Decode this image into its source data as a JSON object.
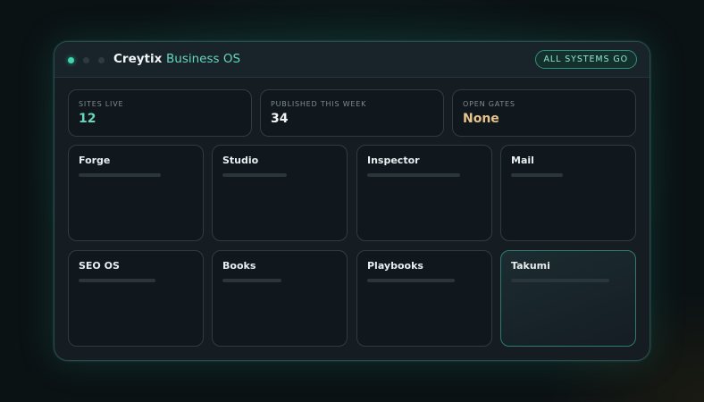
{
  "window": {
    "brand": "Creytix",
    "product": "Business OS",
    "status": "ALL SYSTEMS GO"
  },
  "stats": [
    {
      "label": "SITES LIVE",
      "value": "12",
      "color": "#66d6be"
    },
    {
      "label": "PUBLISHED THIS WEEK",
      "value": "34",
      "color": "#f1f5f6"
    },
    {
      "label": "OPEN GATES",
      "value": "None",
      "color": "#e8c48c"
    }
  ],
  "apps": [
    {
      "name": "Forge",
      "active": false
    },
    {
      "name": "Studio",
      "active": false
    },
    {
      "name": "Inspector",
      "active": false
    },
    {
      "name": "Mail",
      "active": false
    },
    {
      "name": "SEO OS",
      "active": false
    },
    {
      "name": "Books",
      "active": false
    },
    {
      "name": "Playbooks",
      "active": false
    },
    {
      "name": "Takumi",
      "active": true
    }
  ],
  "colors": {
    "accent": "#66d6be",
    "status_dot": "#3ed6b0",
    "warning": "#e8c48c"
  }
}
